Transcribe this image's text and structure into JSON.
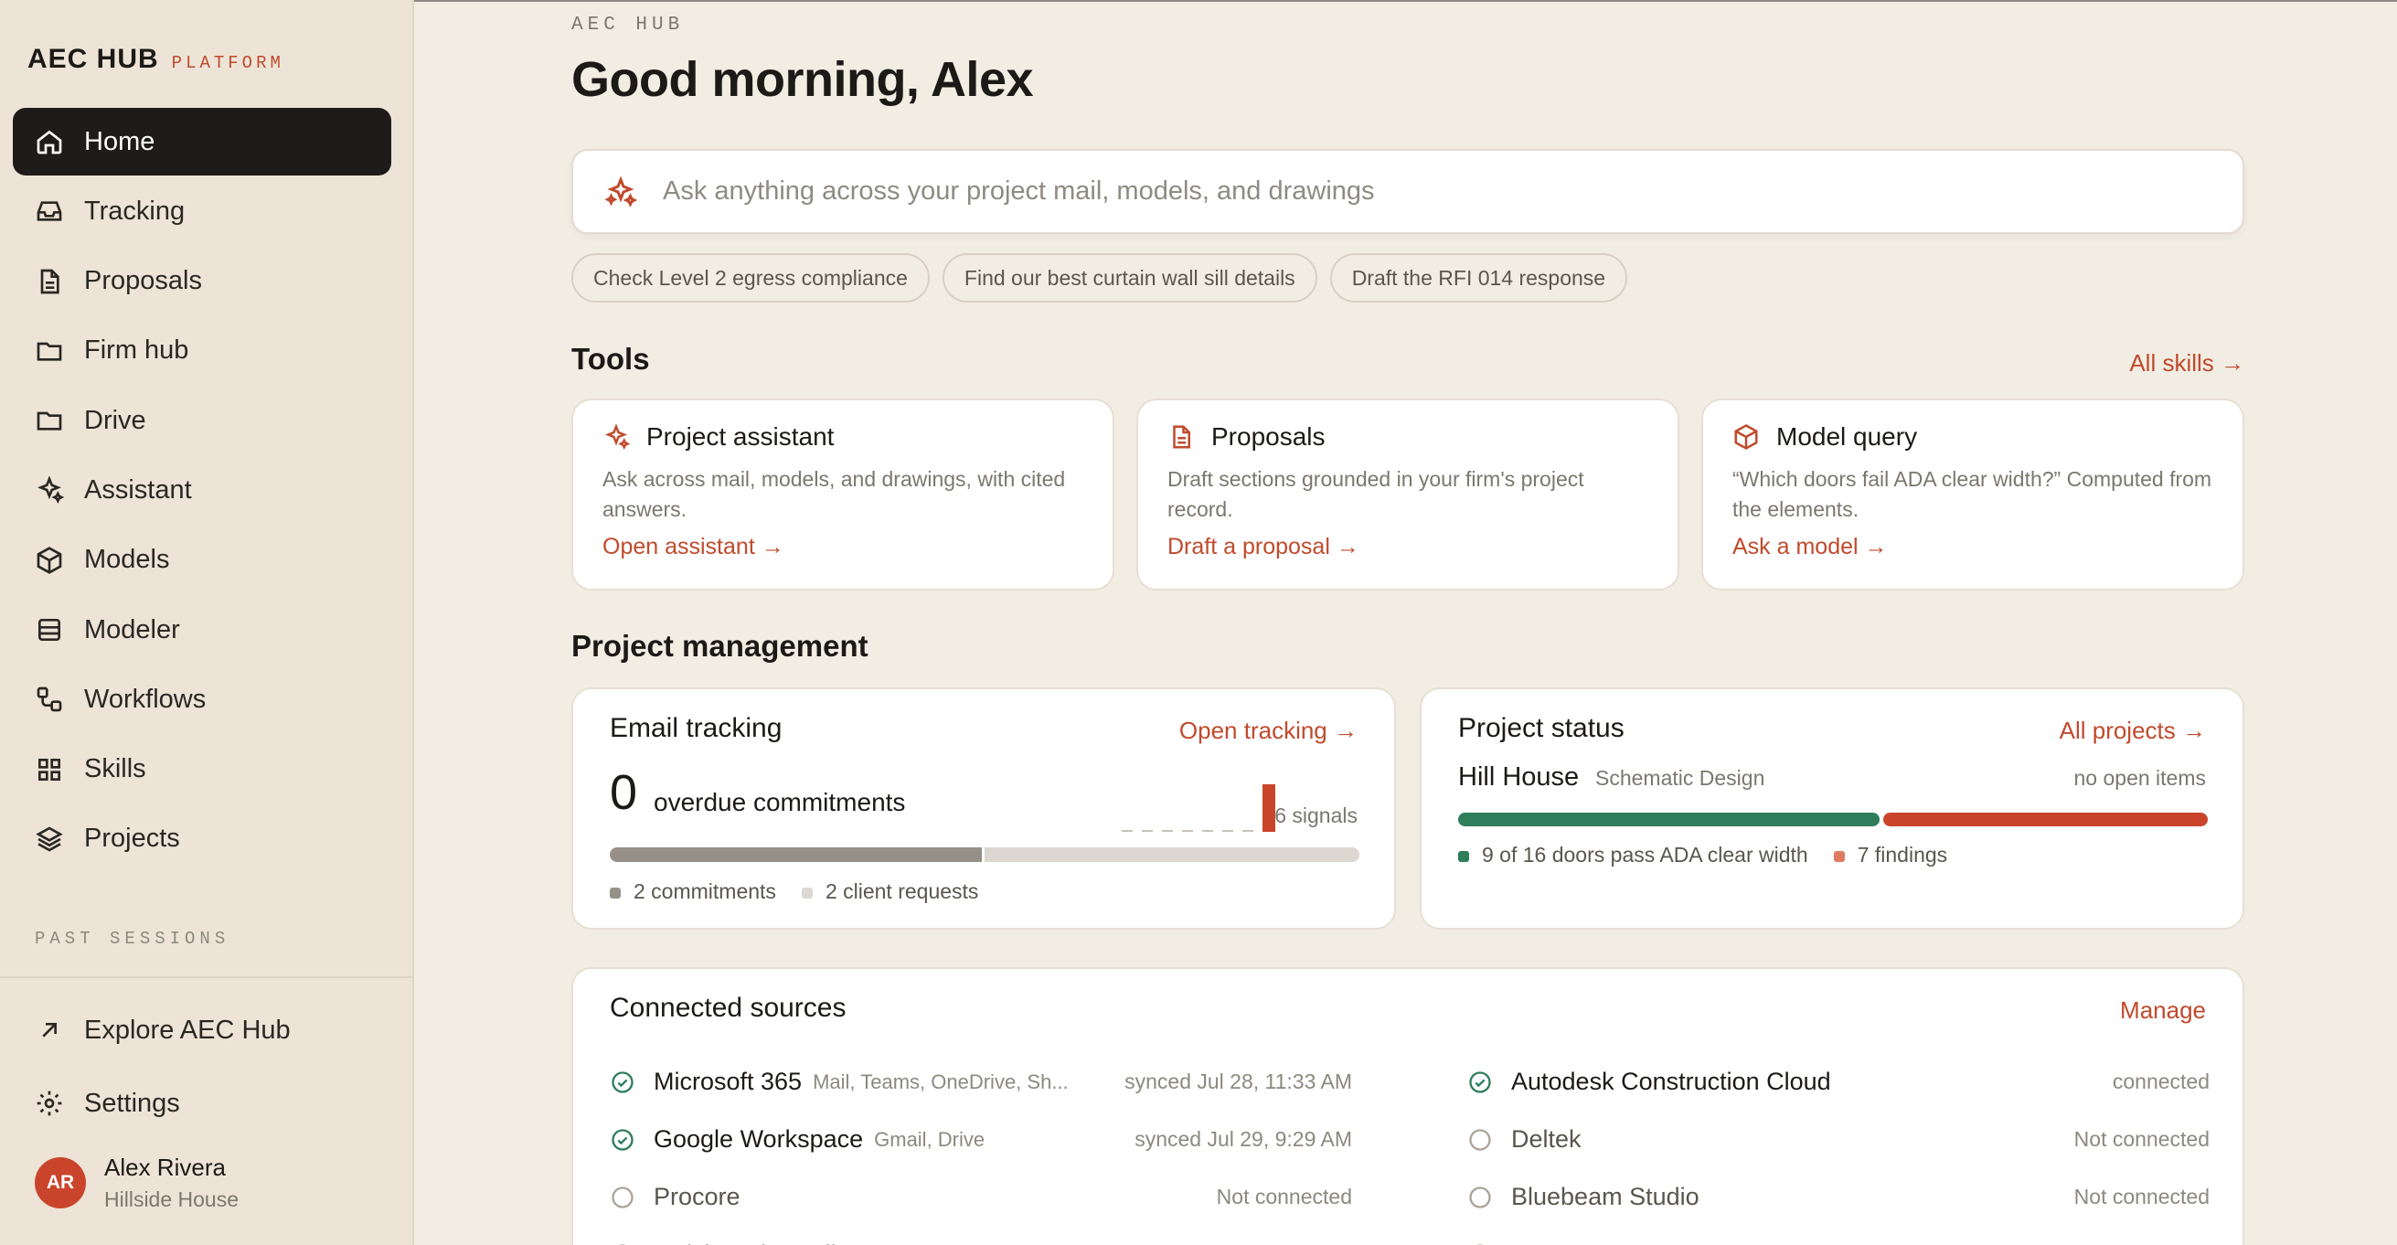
{
  "brand": {
    "name": "AEC HUB",
    "sub": "PLATFORM"
  },
  "nav": [
    {
      "label": "Home",
      "icon": "home-icon",
      "active": true
    },
    {
      "label": "Tracking",
      "icon": "inbox-icon"
    },
    {
      "label": "Proposals",
      "icon": "document-icon"
    },
    {
      "label": "Firm hub",
      "icon": "folder-icon"
    },
    {
      "label": "Drive",
      "icon": "folder-icon"
    },
    {
      "label": "Assistant",
      "icon": "sparkle-icon"
    },
    {
      "label": "Models",
      "icon": "cube-icon"
    },
    {
      "label": "Modeler",
      "icon": "table-icon"
    },
    {
      "label": "Workflows",
      "icon": "workflow-icon"
    },
    {
      "label": "Skills",
      "icon": "grid-icon"
    },
    {
      "label": "Projects",
      "icon": "layers-icon"
    }
  ],
  "past_sessions_label": "PAST SESSIONS",
  "bottom_nav": [
    {
      "label": "Explore AEC Hub",
      "icon": "arrow-up-right-icon"
    },
    {
      "label": "Settings",
      "icon": "gear-icon"
    }
  ],
  "user": {
    "initials": "AR",
    "name": "Alex Rivera",
    "org": "Hillside House"
  },
  "main": {
    "eyebrow": "AEC HUB",
    "greeting": "Good morning, Alex",
    "ask_placeholder": "Ask anything across your project mail, models, and drawings",
    "chips": [
      "Check Level 2 egress compliance",
      "Find our best curtain wall sill details",
      "Draft the RFI 014 response"
    ]
  },
  "tools": {
    "title": "Tools",
    "link": "All skills →",
    "cards": [
      {
        "title": "Project assistant",
        "icon": "sparkle-icon",
        "desc": "Ask across mail, models, and drawings, with cited answers.",
        "link": "Open assistant →"
      },
      {
        "title": "Proposals",
        "icon": "document-icon",
        "desc": "Draft sections grounded in your firm's project record.",
        "link": "Draft a proposal →"
      },
      {
        "title": "Model query",
        "icon": "cube-icon",
        "desc": "“Which doors fail ADA clear width?” Computed from the elements.",
        "link": "Ask a model →"
      }
    ]
  },
  "pm": {
    "title": "Project management",
    "email": {
      "title": "Email tracking",
      "link": "Open tracking →",
      "count": "0",
      "count_label": "overdue commitments",
      "signals": "6 signals",
      "spark_values": [
        0,
        0,
        0,
        0,
        0,
        0,
        0,
        1
      ],
      "commitments": 2,
      "client_requests": 2,
      "legend": [
        "2 commitments",
        "2 client requests"
      ]
    },
    "status": {
      "title": "Project status",
      "link": "All projects →",
      "project": "Hill House",
      "phase": "Schematic Design",
      "open_items": "no open items",
      "pass": 9,
      "total": 16,
      "findings": 7,
      "legend": [
        "9 of 16 doors pass ADA clear width",
        "7 findings"
      ]
    }
  },
  "sources": {
    "title": "Connected sources",
    "link": "Manage",
    "left": [
      {
        "name": "Microsoft 365",
        "sub": "Mail, Teams, OneDrive, Sh...",
        "status": "synced Jul 28, 11:33 AM",
        "connected": true
      },
      {
        "name": "Google Workspace",
        "sub": "Gmail, Drive",
        "status": "synced Jul 29, 9:29 AM",
        "connected": true
      },
      {
        "name": "Procore",
        "sub": "",
        "status": "Not connected",
        "connected": false
      },
      {
        "name": "QuickBooks Online",
        "sub": "",
        "status": "Not connected",
        "connected": false
      }
    ],
    "right": [
      {
        "name": "Autodesk Construction Cloud",
        "sub": "",
        "status": "connected",
        "connected": true
      },
      {
        "name": "Deltek",
        "sub": "",
        "status": "Not connected",
        "connected": false
      },
      {
        "name": "Bluebeam Studio",
        "sub": "",
        "status": "Not connected",
        "connected": false
      },
      {
        "name": "BQE Core",
        "sub": "",
        "status": "Not connected",
        "connected": false
      }
    ]
  },
  "colors": {
    "accent": "#c04a2c",
    "green": "#2e7d5b",
    "red": "#c9442a",
    "dark": "#1e1c1a"
  }
}
